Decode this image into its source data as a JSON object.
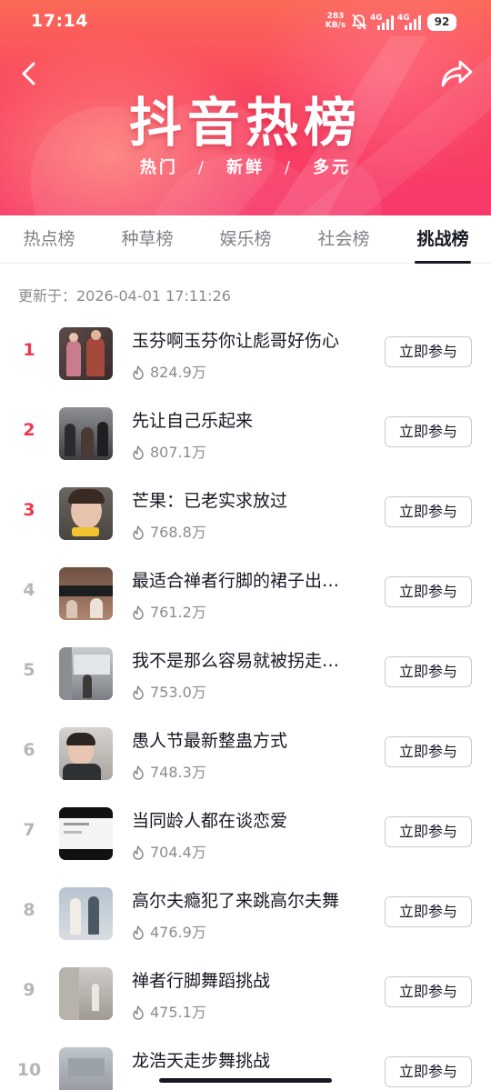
{
  "status": {
    "time": "17:14",
    "speed_value": "283",
    "speed_unit": "KB/s",
    "network_1": "4G",
    "network_2": "4G",
    "battery": "92"
  },
  "header": {
    "title": "抖音热榜",
    "subtitle_items": [
      "热门",
      "新鲜",
      "多元"
    ],
    "separator": "/",
    "back_icon": "chevron-left-icon",
    "share_icon": "share-arrow-icon"
  },
  "tabs": [
    {
      "label": "热点榜",
      "active": false
    },
    {
      "label": "种草榜",
      "active": false
    },
    {
      "label": "娱乐榜",
      "active": false
    },
    {
      "label": "社会榜",
      "active": false
    },
    {
      "label": "挑战榜",
      "active": true
    }
  ],
  "updated_text": "更新于：2026-04-01 17:11:26",
  "list": [
    {
      "rank": "1",
      "title": "玉芬啊玉芬你让彪哥好伤心",
      "heat": "824.9万",
      "button": "立即参与",
      "top": true
    },
    {
      "rank": "2",
      "title": "先让自己乐起来",
      "heat": "807.1万",
      "button": "立即参与",
      "top": true
    },
    {
      "rank": "3",
      "title": "芒果：已老实求放过",
      "heat": "768.8万",
      "button": "立即参与",
      "top": true
    },
    {
      "rank": "4",
      "title": "最适合禅者行脚的裙子出…",
      "heat": "761.2万",
      "button": "立即参与",
      "top": false
    },
    {
      "rank": "5",
      "title": "我不是那么容易就被拐走…",
      "heat": "753.0万",
      "button": "立即参与",
      "top": false
    },
    {
      "rank": "6",
      "title": "愚人节最新整蛊方式",
      "heat": "748.3万",
      "button": "立即参与",
      "top": false
    },
    {
      "rank": "7",
      "title": "当同龄人都在谈恋爱",
      "heat": "704.4万",
      "button": "立即参与",
      "top": false
    },
    {
      "rank": "8",
      "title": "高尔夫瘾犯了来跳高尔夫舞",
      "heat": "476.9万",
      "button": "立即参与",
      "top": false
    },
    {
      "rank": "9",
      "title": "禅者行脚舞蹈挑战",
      "heat": "475.1万",
      "button": "立即参与",
      "top": false
    },
    {
      "rank": "10",
      "title": "龙浩天走步舞挑战",
      "heat": "",
      "button": "立即参与",
      "top": false
    }
  ],
  "colors": {
    "accent_red": "#f0384e",
    "rank_gray": "#b5b6ba",
    "banner_start": "#fb6a57",
    "banner_end": "#f7396a"
  }
}
